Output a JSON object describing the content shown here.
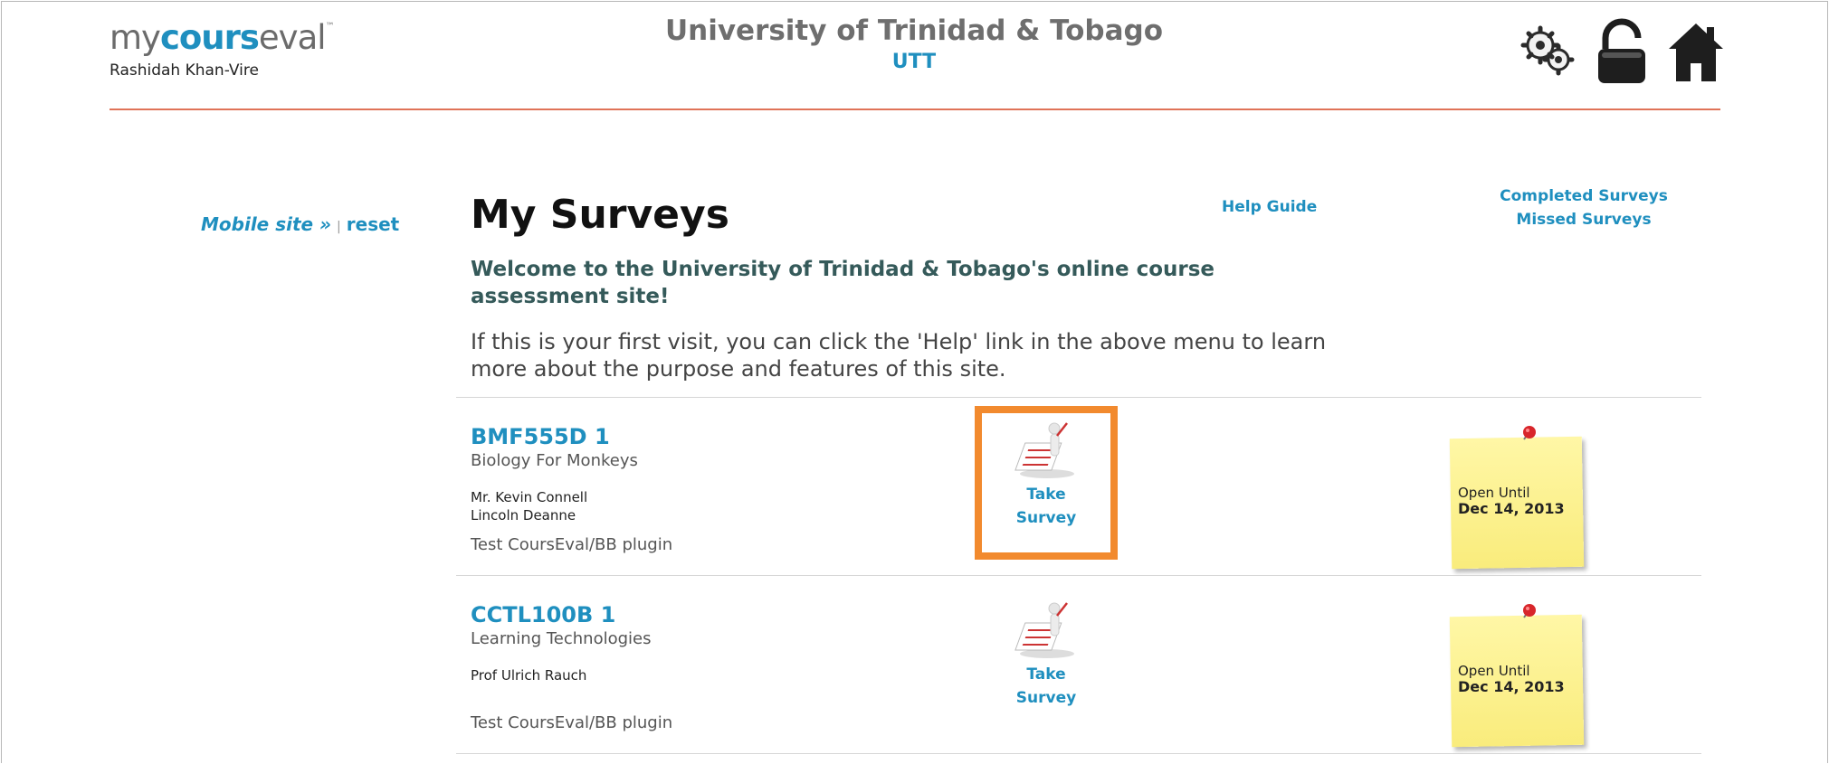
{
  "brand": {
    "logo_left": "my",
    "logo_bold": "cours",
    "logo_right": "eval",
    "logo_tm": "™"
  },
  "user": {
    "name": "Rashidah Khan-Vire"
  },
  "institution": {
    "name": "University of Trinidad & Tobago",
    "abbr": "UTT"
  },
  "header_icons": [
    "settings-gears-icon",
    "lock-icon",
    "home-icon"
  ],
  "nav": {
    "mobile_site": "Mobile site »",
    "separator": "|",
    "reset": "reset"
  },
  "page": {
    "title": "My Surveys",
    "help_guide": "Help Guide",
    "completed_surveys": "Completed Surveys",
    "missed_surveys": "Missed Surveys",
    "welcome": "Welcome to the University of Trinidad & Tobago's online course assessment site!",
    "intro": "If this is your first visit, you can click the 'Help' link in the above menu to learn more about the purpose and features of this site."
  },
  "surveys": [
    {
      "code": "BMF555D 1",
      "name": "Biology For Monkeys",
      "instructor1": "Mr. Kevin Connell",
      "instructor2": "Lincoln Deanne",
      "plugin": "Test CoursEval/BB plugin",
      "take_line1": "Take",
      "take_line2": "Survey",
      "open_label": "Open Until",
      "open_date": "Dec 14, 2013"
    },
    {
      "code": "CCTL100B 1",
      "name": "Learning Technologies",
      "instructor1": "Prof Ulrich Rauch",
      "plugin": "Test CoursEval/BB plugin",
      "take_line1": "Take",
      "take_line2": "Survey",
      "open_label": "Open Until",
      "open_date": "Dec 14, 2013"
    }
  ],
  "colors": {
    "accent": "#1f8fbf",
    "rule": "#e07358",
    "highlight": "#f28a2e",
    "note": "#f9ec7c"
  }
}
